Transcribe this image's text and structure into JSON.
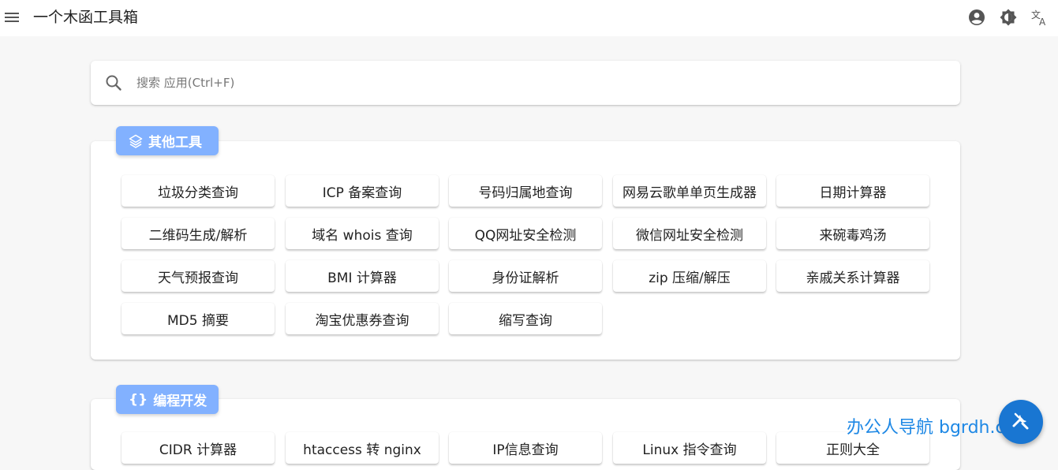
{
  "app": {
    "title": "一个木函工具箱"
  },
  "colors": {
    "badge": "#82b1ff",
    "fab": "#1976d2",
    "watermark": "#1e88e5",
    "icon": "#555555"
  },
  "toolbar_icons": [
    "menu-icon",
    "account-circle-icon",
    "brightness-icon",
    "translate-icon"
  ],
  "search": {
    "placeholder": "搜索 应用(Ctrl+F)",
    "value": ""
  },
  "sections": [
    {
      "title": "其他工具",
      "icon": "layers-icon",
      "tools": [
        "垃圾分类查询",
        "ICP 备案查询",
        "号码归属地查询",
        "网易云歌单单页生成器",
        "日期计算器",
        "二维码生成/解析",
        "域名 whois 查询",
        "QQ网址安全检测",
        "微信网址安全检测",
        "来碗毒鸡汤",
        "天气预报查询",
        "BMI 计算器",
        "身份证解析",
        "zip 压缩/解压",
        "亲戚关系计算器",
        "MD5 摘要",
        "淘宝优惠券查询",
        "缩写查询"
      ]
    },
    {
      "title": "编程开发",
      "icon": "code-braces-icon",
      "icon_text": "{}",
      "tools": [
        "CIDR 计算器",
        "htaccess 转 nginx",
        "IP信息查询",
        "Linux 指令查询",
        "正则大全"
      ]
    }
  ],
  "watermark": "办公人导航 bgrdh.com",
  "fab": {
    "icon": "tools-icon"
  }
}
